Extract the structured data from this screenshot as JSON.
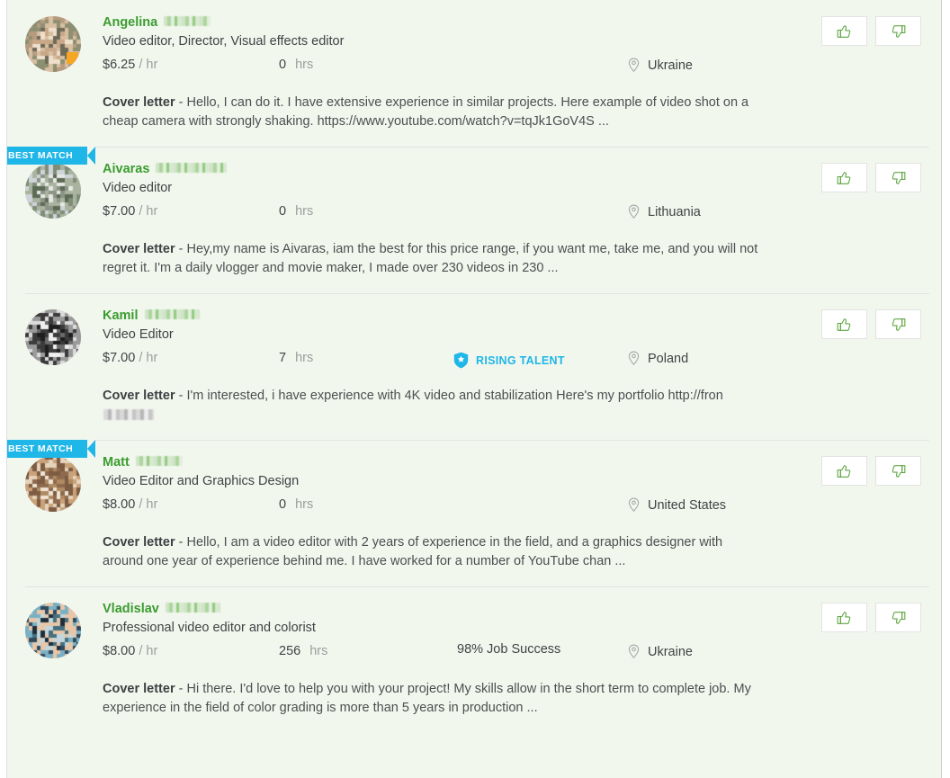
{
  "colors": {
    "page_background": "#f2f7ee",
    "name_green": "#3a9c2f",
    "badge_cyan": "#1fb6e8",
    "text": "#404345",
    "muted": "#9b9e9c",
    "online_dot": "#f5a623"
  },
  "labels": {
    "best_match": "BEST MATCH",
    "rising_talent": "RISING TALENT",
    "cover_letter_label": "Cover letter",
    "cover_letter_sep": " - ",
    "per_hr": "/ hr",
    "hrs_unit": "hrs",
    "thumbs_up": "thumbs-up",
    "thumbs_down": "thumbs-down"
  },
  "proposals": [
    {
      "best_match": false,
      "name": "Angelina",
      "surname_redacted": true,
      "title": "Video editor, Director, Visual effects editor",
      "rate": "$6.25",
      "hours": "0",
      "location": "Ukraine",
      "rising_talent": false,
      "job_success": null,
      "online_badge": true,
      "cover_letter": "Hello, I can do it. I have extensive experience in similar projects. Here example of video shot on a cheap camera with strongly shaking. https://www.youtube.com/watch?v=tqJk1GoV4S ...",
      "cover_letter_redacted_url": false
    },
    {
      "best_match": true,
      "name": "Aivaras",
      "surname_redacted": true,
      "title": "Video editor",
      "rate": "$7.00",
      "hours": "0",
      "location": "Lithuania",
      "rising_talent": false,
      "job_success": null,
      "online_badge": false,
      "cover_letter": "Hey,my name is Aivaras, iam the best for this price range, if you want me, take me, and you will not regret it. I'm a daily vlogger and movie maker, I made over 230 videos in 230 ...",
      "cover_letter_redacted_url": false
    },
    {
      "best_match": false,
      "name": "Kamil",
      "surname_redacted": true,
      "title": "Video Editor",
      "rate": "$7.00",
      "hours": "7",
      "location": "Poland",
      "rising_talent": true,
      "job_success": null,
      "online_badge": false,
      "cover_letter": "I'm interested, i have experience with 4K video and stabilization Here's my portfolio http://fron",
      "cover_letter_redacted_url": true
    },
    {
      "best_match": true,
      "name": "Matt",
      "surname_redacted": true,
      "title": "Video Editor and Graphics Design",
      "rate": "$8.00",
      "hours": "0",
      "location": "United States",
      "rising_talent": false,
      "job_success": null,
      "online_badge": false,
      "cover_letter": "Hello, I am a video editor with 2 years of experience in the field, and a graphics designer with around one year of experience behind me. I have worked for a number of YouTube chan ...",
      "cover_letter_redacted_url": false
    },
    {
      "best_match": false,
      "name": "Vladislav",
      "surname_redacted": true,
      "title": "Professional video editor and colorist",
      "rate": "$8.00",
      "hours": "256",
      "location": "Ukraine",
      "rising_talent": false,
      "job_success": "98% Job Success",
      "job_success_percent": 98,
      "online_badge": false,
      "cover_letter": "Hi there. I'd love to help you with your project! My skills allow in the short term to complete job. My experience in the field of color grading is more than 5 years in production ...",
      "cover_letter_redacted_url": false
    }
  ]
}
